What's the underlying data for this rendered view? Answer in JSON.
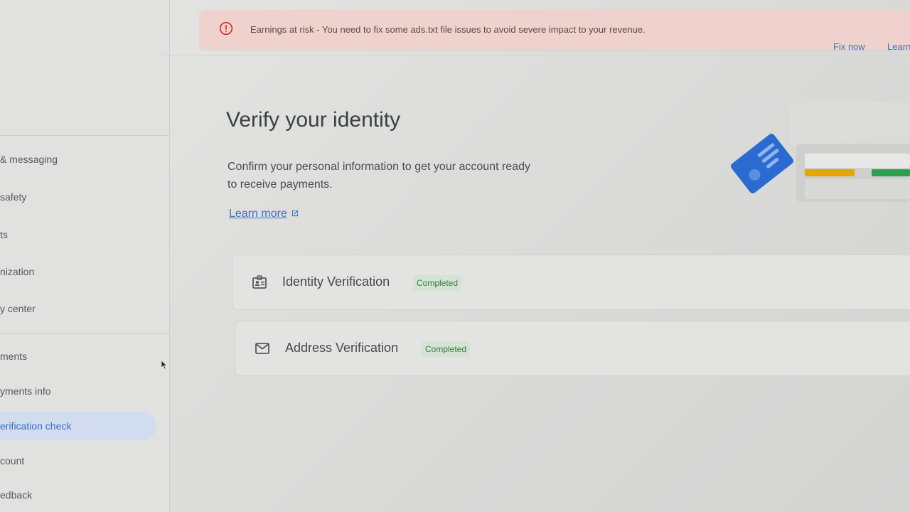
{
  "banner": {
    "message": "Earnings at risk - You need to fix some ads.txt file issues to avoid severe impact to your revenue.",
    "fix_label": "Fix now",
    "learn_label": "Learn",
    "icon": "alert-circle-icon",
    "accent": "#d93025"
  },
  "sidebar": {
    "items": [
      {
        "label": "& messaging"
      },
      {
        "label": "safety"
      },
      {
        "label": "ts"
      },
      {
        "label": "nization"
      },
      {
        "label": "y center"
      },
      {
        "label": "ments"
      },
      {
        "label": "yments info"
      },
      {
        "label": "erification check"
      },
      {
        "label": "count"
      },
      {
        "label": "edback"
      }
    ],
    "active_index": 7
  },
  "main": {
    "title": "Verify your identity",
    "description": "Confirm your personal information to get your account ready to receive payments.",
    "learn_more": "Learn more",
    "verifications": [
      {
        "label": "Identity Verification",
        "status": "Completed",
        "icon": "id-card-icon"
      },
      {
        "label": "Address Verification",
        "status": "Completed",
        "icon": "mail-icon"
      }
    ]
  },
  "colors": {
    "link": "#3d72c9",
    "success_text": "#3b7a44",
    "success_bg": "#d4e3d3",
    "banner_bg": "#efd2cd",
    "active_nav_bg": "#d1dcee"
  }
}
